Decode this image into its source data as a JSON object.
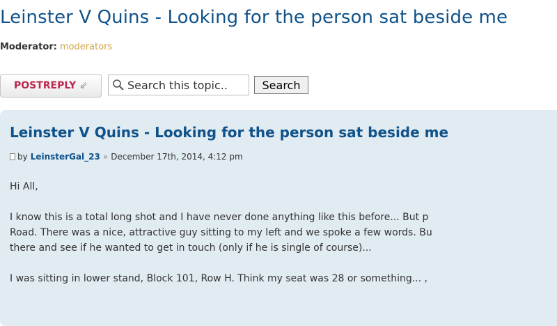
{
  "topic": {
    "title": "Leinster V Quins - Looking for the person sat beside me",
    "moderator_label": "Moderator:",
    "moderator_link": "moderators"
  },
  "actions": {
    "postreply_label": "POSTREPLY",
    "postreply_icon": "reply-arrow-icon",
    "search_text": "Search this topic..",
    "search_button": "Search"
  },
  "post": {
    "title": "Leinster V Quins - Looking for the person sat beside me",
    "by": "by",
    "author": "LeinsterGal_23",
    "separator": "»",
    "date": "December 17th, 2014, 4:12 pm",
    "body": {
      "greeting": "Hi All,",
      "line1": "I know this is a total long shot and I have never done anything like this before... But p",
      "line2": "Road. There was a nice, attractive guy sitting to my left and we spoke a few words. Bu",
      "line3": "there and see if he wanted to get in touch (only if he is single of course)...",
      "line4": "I was sitting in lower stand, Block 101, Row H. Think my seat was 28 or something... ,"
    }
  },
  "colors": {
    "link_blue": "#105289",
    "panel_bg": "#e1ebf2",
    "postreply_red": "#bc2a4d",
    "moderator_gold": "#d0a341"
  }
}
